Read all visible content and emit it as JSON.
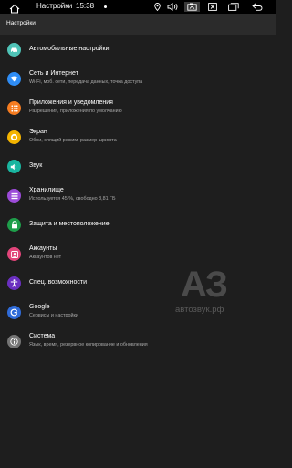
{
  "status_bar": {
    "title": "Настройки",
    "time": "15:38",
    "icons": [
      "home-icon",
      "location-icon",
      "volume-icon",
      "screenshot-icon",
      "close-box-icon",
      "recents-icon",
      "back-icon"
    ]
  },
  "header": {
    "title": "Настройки"
  },
  "settings": [
    {
      "title": "Автомобильные настройки",
      "subtitle": "",
      "icon": "car-icon",
      "color": "#4fc3b7"
    },
    {
      "title": "Сеть и Интернет",
      "subtitle": "Wi-Fi, моб. сети, передача данных, точка доступа",
      "icon": "wifi-icon",
      "color": "#2f8df5"
    },
    {
      "title": "Приложения и уведомления",
      "subtitle": "Разрешения, приложения по умолчанию",
      "icon": "apps-icon",
      "color": "#f57c20"
    },
    {
      "title": "Экран",
      "subtitle": "Обои, спящий режим, размер шрифта",
      "icon": "brightness-icon",
      "color": "#f4b400"
    },
    {
      "title": "Звук",
      "subtitle": "",
      "icon": "sound-icon",
      "color": "#1ab5a0"
    },
    {
      "title": "Хранилище",
      "subtitle": "Используется 45 %, свободно 8,81 ГБ",
      "icon": "storage-icon",
      "color": "#9c4bd8"
    },
    {
      "title": "Защита и местоположение",
      "subtitle": "",
      "icon": "lock-icon",
      "color": "#1e9e4a"
    },
    {
      "title": "Аккаунты",
      "subtitle": "Аккаунтов нет",
      "icon": "account-icon",
      "color": "#e2457a"
    },
    {
      "title": "Спец. возможности",
      "subtitle": "",
      "icon": "accessibility-icon",
      "color": "#6a2fc0"
    },
    {
      "title": "Google",
      "subtitle": "Сервисы и настройки",
      "icon": "google-icon",
      "color": "#2f6bd8"
    },
    {
      "title": "Система",
      "subtitle": "Язык, время, резервное копирование и обновления",
      "icon": "info-icon",
      "color": "#757575"
    }
  ],
  "watermark": {
    "logo": "АЗ",
    "text": "автозвук.рф"
  }
}
